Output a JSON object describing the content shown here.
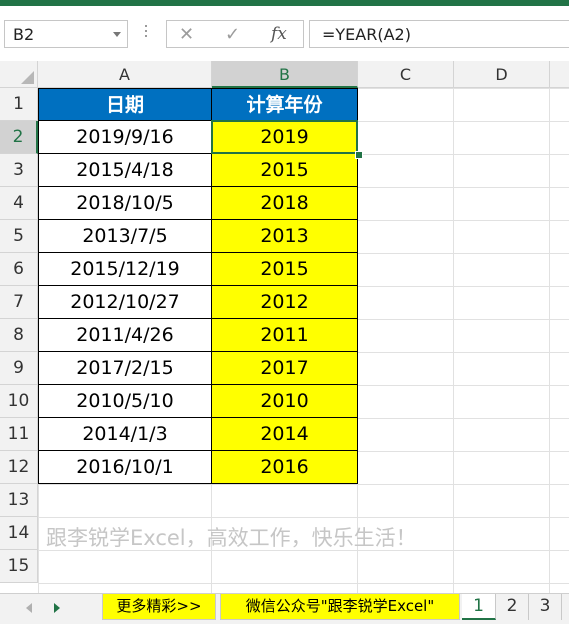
{
  "name_box": {
    "value": "B2"
  },
  "formula_bar": {
    "cancel_icon": "✕",
    "enter_icon": "✓",
    "fx_label": "fx",
    "formula": "=YEAR(A2)"
  },
  "columns": [
    "A",
    "B",
    "C",
    "D"
  ],
  "rows": [
    "1",
    "2",
    "3",
    "4",
    "5",
    "6",
    "7",
    "8",
    "9",
    "10",
    "11",
    "12",
    "13",
    "14",
    "15"
  ],
  "table": {
    "headers": [
      "日期",
      "计算年份"
    ],
    "rows": [
      [
        "2019/9/16",
        "2019"
      ],
      [
        "2015/4/18",
        "2015"
      ],
      [
        "2018/10/5",
        "2018"
      ],
      [
        "2013/7/5",
        "2013"
      ],
      [
        "2015/12/19",
        "2015"
      ],
      [
        "2012/10/27",
        "2012"
      ],
      [
        "2011/4/26",
        "2011"
      ],
      [
        "2017/2/15",
        "2017"
      ],
      [
        "2010/5/10",
        "2010"
      ],
      [
        "2014/1/3",
        "2014"
      ],
      [
        "2016/10/1",
        "2016"
      ]
    ]
  },
  "note": "跟李锐学Excel，高效工作，快乐生活！",
  "sheet_tabs": [
    "更多精彩>>",
    "微信公众号\"跟李锐学Excel\"",
    "1",
    "2",
    "3"
  ],
  "colors": {
    "header_blue": "#0070c0",
    "highlight_yellow": "#ffff00",
    "excel_green": "#217346"
  }
}
